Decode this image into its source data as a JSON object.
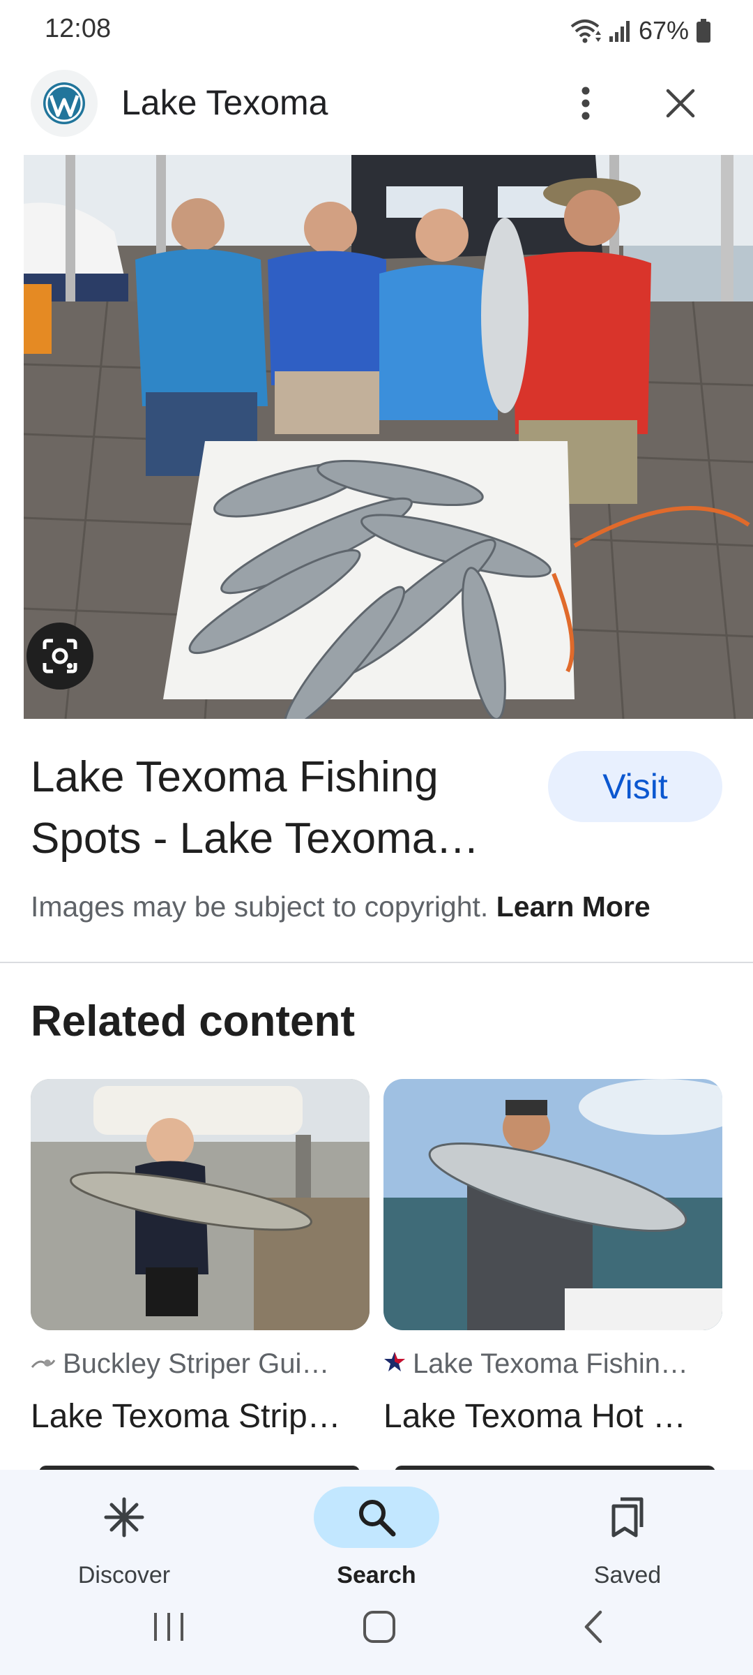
{
  "status_bar": {
    "time": "12:08",
    "battery": "67%",
    "icons": [
      "wifi-icon",
      "signal-icon",
      "battery-icon"
    ]
  },
  "header": {
    "site_logo": "wordpress-logo",
    "site_name": "Lake Texoma"
  },
  "hero": {
    "image_subject": "four men kneeling behind a cooler full of striped bass on a boat dock"
  },
  "result": {
    "title": "Lake Texoma Fishing Spots - Lake Texoma…",
    "visit_label": "Visit",
    "copyright_text": "Images may be subject to copyright.",
    "learn_more_label": "Learn More"
  },
  "related": {
    "heading": "Related content",
    "cards": [
      {
        "source": "Buckley Striper Gui…",
        "title": "Lake Texoma Strip…",
        "image_subject": "young boy holding a striped bass"
      },
      {
        "source": "Lake Texoma Fishin…",
        "title": "Lake Texoma Hot …",
        "image_subject": "man on a boat holding a large striped bass"
      }
    ]
  },
  "bottom_nav": {
    "items": [
      {
        "label": "Discover",
        "icon": "asterisk-icon",
        "active": false
      },
      {
        "label": "Search",
        "icon": "search-icon",
        "active": true
      },
      {
        "label": "Saved",
        "icon": "bookmarks-icon",
        "active": false
      }
    ]
  },
  "colors": {
    "accent_blue": "#0b57d0",
    "visit_bg": "#e8f0fe",
    "nav_active_pill": "#c2e7ff",
    "nav_bg": "#f3f6fc"
  }
}
